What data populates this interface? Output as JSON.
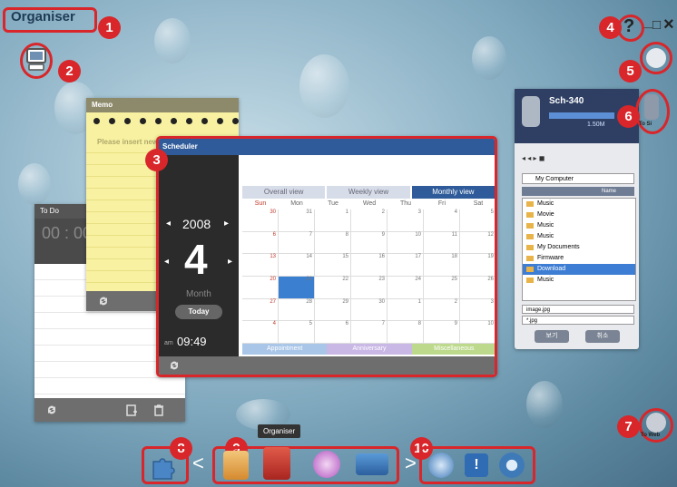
{
  "window": {
    "title": "Organiser",
    "help_glyph": "?",
    "minimize_glyph": "_",
    "maximize_glyph": "□",
    "close_glyph": "×"
  },
  "callouts": [
    "1",
    "2",
    "3",
    "4",
    "5",
    "6",
    "7",
    "8",
    "9",
    "10"
  ],
  "memo": {
    "title": "Memo",
    "placeholder": "Please insert new memo."
  },
  "todo": {
    "title": "To Do",
    "clock": "00 : 00"
  },
  "scheduler": {
    "title": "Scheduler",
    "tabs": [
      "Overall view",
      "Weekly view",
      "Monthly view"
    ],
    "active_tab": "Monthly view",
    "weekdays": [
      "Sun",
      "Mon",
      "Tue",
      "Wed",
      "Thu",
      "Fri",
      "Sat"
    ],
    "year": "2008",
    "month": "4",
    "month_label": "Month",
    "today_label": "Today",
    "time_prefix": "am",
    "time": "09:49",
    "days": [
      "30",
      "31",
      "1",
      "2",
      "3",
      "4",
      "5",
      "6",
      "7",
      "8",
      "9",
      "10",
      "11",
      "12",
      "13",
      "14",
      "15",
      "16",
      "17",
      "18",
      "19",
      "20",
      "21",
      "22",
      "23",
      "24",
      "25",
      "26",
      "27",
      "28",
      "29",
      "30",
      "1",
      "2",
      "3",
      "4",
      "5",
      "6",
      "7",
      "8",
      "9",
      "10"
    ],
    "selected_day_index": 22,
    "legend": [
      "Appointment",
      "Anniversary",
      "Miscellaneous"
    ]
  },
  "phone": {
    "model": "Sch-340",
    "memory": "1.50M",
    "location": "My Computer",
    "column": "Name",
    "folders": [
      "Music",
      "Movie",
      "Music",
      "Music",
      "My Documents",
      "Firmware",
      "Download",
      "Music"
    ],
    "selected_folder_index": 6,
    "filename": "image.jpg",
    "filetype": "*.jpg",
    "ok_label": "보기",
    "cancel_label": "취소"
  },
  "side_buttons": {
    "phone_label": "To Si",
    "web_label": "To Web"
  },
  "tooltip": "Organiser",
  "toolbar": {
    "prev_glyph": "<",
    "next_glyph": ">"
  }
}
